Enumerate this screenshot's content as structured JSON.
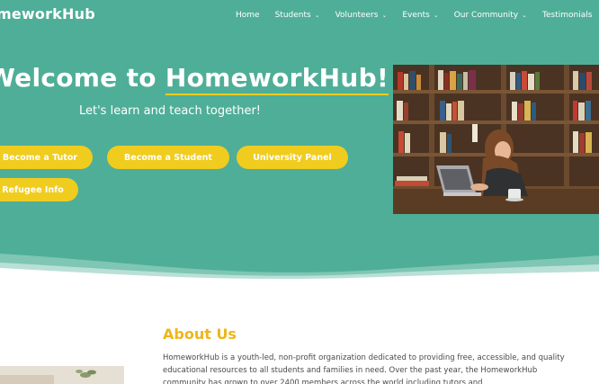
{
  "header": {
    "logo": "meworkHub",
    "nav": [
      {
        "label": "Home",
        "dropdown": false
      },
      {
        "label": "Students",
        "dropdown": true
      },
      {
        "label": "Volunteers",
        "dropdown": true
      },
      {
        "label": "Events",
        "dropdown": true
      },
      {
        "label": "Our Community",
        "dropdown": true
      },
      {
        "label": "Testimonials",
        "dropdown": false
      }
    ]
  },
  "hero": {
    "title_prefix": "Welcome to ",
    "title_brand": "HomeworkHub!",
    "subtitle": "Let's learn and teach together!",
    "buttons": {
      "tutor": "Become a Tutor",
      "student": "Become a Student",
      "university": "University Panel",
      "refugee": "Refugee Info"
    }
  },
  "about": {
    "title": "About Us",
    "body": "HomeworkHub is a youth-led, non-profit organization dedicated to providing free, accessible, and quality educational resources to all students and families in need. Over the past year, the HomeworkHub community has grown to over 2400 members across the world including tutors and"
  },
  "colors": {
    "hero_bg": "#4fae98",
    "accent_yellow": "#f0cc1e",
    "about_title": "#efb51a"
  }
}
